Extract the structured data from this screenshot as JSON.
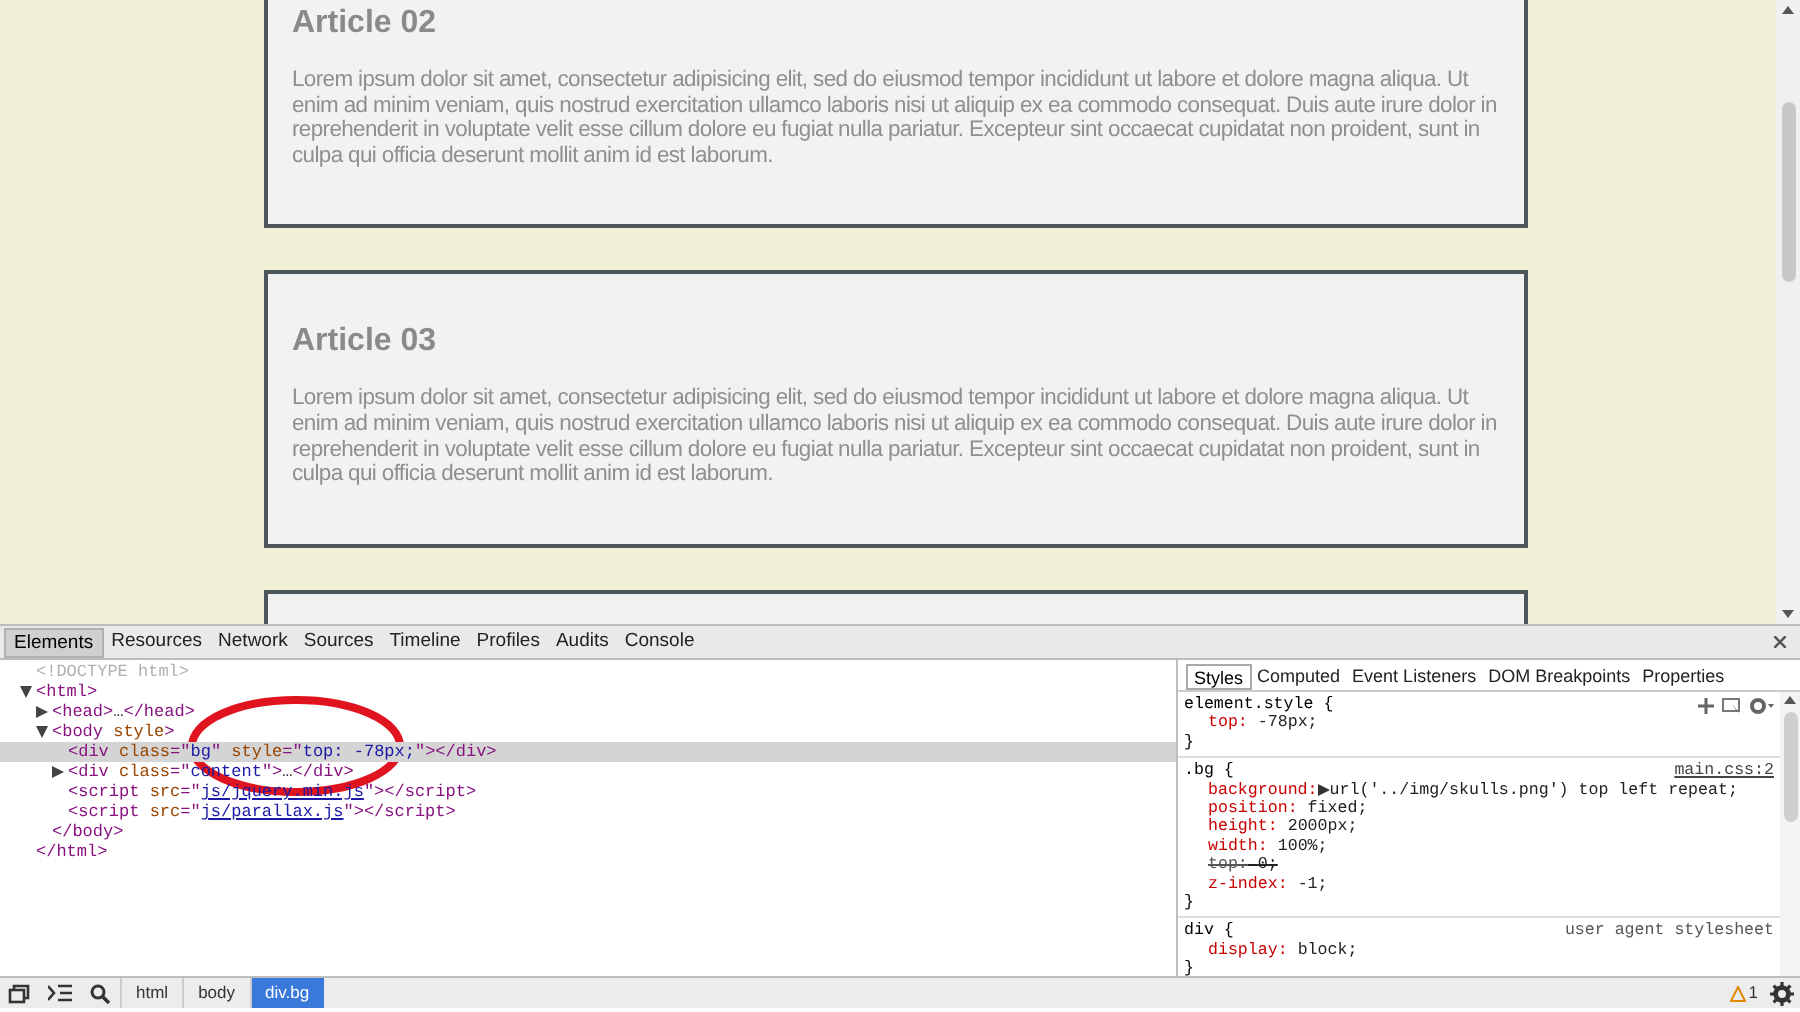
{
  "page": {
    "articles": [
      {
        "kind": "article",
        "title": "Article 02",
        "body": "Lorem ipsum dolor sit amet, consectetur adipisicing elit, sed do eiusmod tempor incididunt ut labore et dolore magna aliqua. Ut enim ad minim veniam, quis nostrud exercitation ullamco laboris nisi ut aliquip ex ea commodo consequat. Duis aute irure dolor in reprehenderit in voluptate velit esse cillum dolore eu fugiat nulla pariatur. Excepteur sint occaecat cupidatat non proident, sunt in culpa qui officia deserunt mollit anim id est laborum."
      },
      {
        "kind": "article",
        "title": "Article 03",
        "body": "Lorem ipsum dolor sit amet, consectetur adipisicing elit, sed do eiusmod tempor incididunt ut labore et dolore magna aliqua. Ut enim ad minim veniam, quis nostrud exercitation ullamco laboris nisi ut aliquip ex ea commodo consequat. Duis aute irure dolor in reprehenderit in voluptate velit esse cillum dolore eu fugiat nulla pariatur. Excepteur sint occaecat cupidatat non proident, sunt in culpa qui officia deserunt mollit anim id est laborum."
      },
      {
        "kind": "empty"
      }
    ]
  },
  "devtools": {
    "tabs": [
      {
        "label": "Elements",
        "selected": true
      },
      {
        "label": "Resources",
        "selected": false
      },
      {
        "label": "Network",
        "selected": false
      },
      {
        "label": "Sources",
        "selected": false
      },
      {
        "label": "Timeline",
        "selected": false
      },
      {
        "label": "Profiles",
        "selected": false
      },
      {
        "label": "Audits",
        "selected": false
      },
      {
        "label": "Console",
        "selected": false
      }
    ],
    "dom_tree": [
      {
        "open": [
          {
            "kind": "doctype",
            "text": "<!DOCTYPE html>"
          }
        ],
        "selected": false
      },
      {
        "open": [
          {
            "kind": "tag",
            "text": "<html>"
          }
        ],
        "expanded": true,
        "selected": false,
        "close": [
          {
            "kind": "tag",
            "text": "</html>"
          }
        ],
        "children": [
          {
            "open": [
              {
                "kind": "tag",
                "text": "<head>"
              },
              {
                "kind": "plain",
                "text": "…"
              },
              {
                "kind": "tag",
                "text": "</head>"
              }
            ],
            "expanded": false,
            "selected": false
          },
          {
            "open": [
              {
                "kind": "tag",
                "text": "<body "
              },
              {
                "kind": "attr",
                "text": "style"
              },
              {
                "kind": "tag",
                "text": ">"
              }
            ],
            "expanded": true,
            "selected": false,
            "close": [
              {
                "kind": "tag",
                "text": "</body>"
              }
            ],
            "children": [
              {
                "open": [
                  {
                    "kind": "tag",
                    "text": "<div "
                  },
                  {
                    "kind": "attr",
                    "text": "class"
                  },
                  {
                    "kind": "tag",
                    "text": "=\""
                  },
                  {
                    "kind": "value",
                    "text": "bg"
                  },
                  {
                    "kind": "tag",
                    "text": "\" "
                  },
                  {
                    "kind": "attr",
                    "text": "style"
                  },
                  {
                    "kind": "tag",
                    "text": "=\""
                  },
                  {
                    "kind": "value",
                    "text": "top: -78px;"
                  },
                  {
                    "kind": "tag",
                    "text": "\"></div>"
                  }
                ],
                "selected": true
              },
              {
                "open": [
                  {
                    "kind": "tag",
                    "text": "<div "
                  },
                  {
                    "kind": "attr",
                    "text": "class"
                  },
                  {
                    "kind": "tag",
                    "text": "=\""
                  },
                  {
                    "kind": "value",
                    "text": "content"
                  },
                  {
                    "kind": "tag",
                    "text": "\">"
                  },
                  {
                    "kind": "plain",
                    "text": "…"
                  },
                  {
                    "kind": "tag",
                    "text": "</div>"
                  }
                ],
                "expanded": false,
                "selected": false
              },
              {
                "open": [
                  {
                    "kind": "tag",
                    "text": "<script "
                  },
                  {
                    "kind": "attr",
                    "text": "src"
                  },
                  {
                    "kind": "tag",
                    "text": "=\""
                  },
                  {
                    "kind": "link",
                    "text": "js/jquery.min.js"
                  },
                  {
                    "kind": "tag",
                    "text": "\"></script>"
                  }
                ],
                "selected": false
              },
              {
                "open": [
                  {
                    "kind": "tag",
                    "text": "<script "
                  },
                  {
                    "kind": "attr",
                    "text": "src"
                  },
                  {
                    "kind": "tag",
                    "text": "=\""
                  },
                  {
                    "kind": "link",
                    "text": "js/parallax.js"
                  },
                  {
                    "kind": "tag",
                    "text": "\"></script>"
                  }
                ],
                "selected": false
              }
            ]
          }
        ]
      }
    ],
    "style_tabs": [
      {
        "label": "Styles",
        "selected": true
      },
      {
        "label": "Computed",
        "selected": false
      },
      {
        "label": "Event Listeners",
        "selected": false
      },
      {
        "label": "DOM Breakpoints",
        "selected": false
      },
      {
        "label": "Properties",
        "selected": false
      }
    ],
    "rules": [
      {
        "kind": "element",
        "selector": "element.style {",
        "close": "}",
        "properties": [
          {
            "name": "top:",
            "value": "-78px;",
            "struck": false
          }
        ]
      },
      {
        "kind": "author",
        "selector": ".bg {",
        "close": "}",
        "source": "main.css:2",
        "properties": [
          {
            "name": "background:",
            "value": "url('../img/skulls.png') top left repeat;",
            "struck": false,
            "expandable": true
          },
          {
            "name": "position:",
            "value": "fixed;",
            "struck": false
          },
          {
            "name": "height:",
            "value": "2000px;",
            "struck": false
          },
          {
            "name": "width:",
            "value": "100%;",
            "struck": false
          },
          {
            "name": "top:",
            "value": "0;",
            "struck": true
          },
          {
            "name": "z-index:",
            "value": "-1;",
            "struck": false
          }
        ]
      },
      {
        "kind": "user_agent",
        "selector": "div {",
        "close": "}",
        "source": "user agent stylesheet",
        "properties": [
          {
            "name": "display:",
            "value": "block;",
            "struck": false
          }
        ]
      }
    ],
    "breadcrumbs": [
      {
        "label": "html",
        "selected": false
      },
      {
        "label": "body",
        "selected": false
      },
      {
        "label": "div.bg",
        "selected": true
      }
    ],
    "warning_count": "1"
  }
}
